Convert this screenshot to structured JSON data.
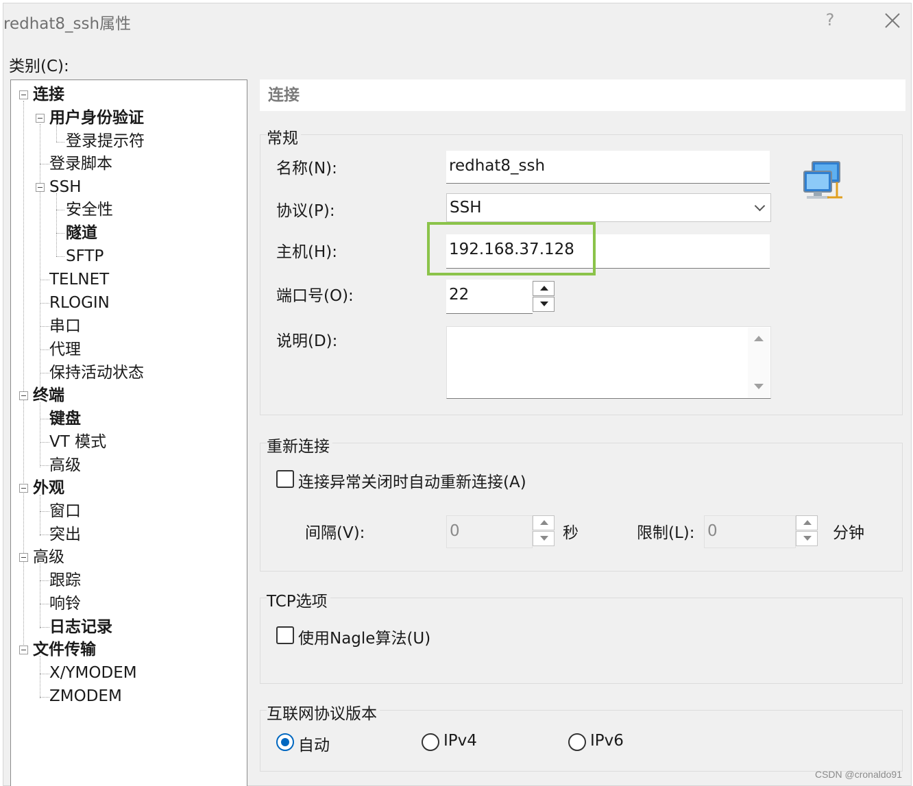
{
  "window": {
    "title": "redhat8_ssh属性",
    "help_label": "?",
    "close_label": "✕"
  },
  "category_label": "类别(C):",
  "tree": {
    "items": [
      {
        "label": "连接"
      },
      {
        "label": "用户身份验证"
      },
      {
        "label": "登录提示符"
      },
      {
        "label": "登录脚本"
      },
      {
        "label": "SSH"
      },
      {
        "label": "安全性"
      },
      {
        "label": "隧道"
      },
      {
        "label": "SFTP"
      },
      {
        "label": "TELNET"
      },
      {
        "label": "RLOGIN"
      },
      {
        "label": "串口"
      },
      {
        "label": "代理"
      },
      {
        "label": "保持活动状态"
      },
      {
        "label": "终端"
      },
      {
        "label": "键盘"
      },
      {
        "label": "VT 模式"
      },
      {
        "label": "高级"
      },
      {
        "label": "外观"
      },
      {
        "label": "窗口"
      },
      {
        "label": "突出"
      },
      {
        "label": "高级"
      },
      {
        "label": "跟踪"
      },
      {
        "label": "响铃"
      },
      {
        "label": "日志记录"
      },
      {
        "label": "文件传输"
      },
      {
        "label": "X/YMODEM"
      },
      {
        "label": "ZMODEM"
      }
    ]
  },
  "panel": {
    "header": "连接",
    "general": {
      "title": "常规",
      "name_label": "名称(N):",
      "name_value": "redhat8_ssh",
      "protocol_label": "协议(P):",
      "protocol_value": "SSH",
      "host_label": "主机(H):",
      "host_value": "192.168.37.128",
      "port_label": "端口号(O):",
      "port_value": "22",
      "desc_label": "说明(D):",
      "desc_value": ""
    },
    "reconnect": {
      "title": "重新连接",
      "auto_label": "连接异常关闭时自动重新连接(A)",
      "interval_label": "间隔(V):",
      "interval_value": "0",
      "interval_unit": "秒",
      "limit_label": "限制(L):",
      "limit_value": "0",
      "limit_unit": "分钟"
    },
    "tcp": {
      "title": "TCP选项",
      "nagle_label": "使用Nagle算法(U)"
    },
    "ip": {
      "title": "互联网协议版本",
      "auto_label": "自动",
      "ipv4_label": "IPv4",
      "ipv6_label": "IPv6",
      "selected": "自动"
    }
  },
  "colors": {
    "highlight": "#8bc34a",
    "radio_accent": "#0067c0"
  },
  "icons": {
    "connection": "network-computers-icon"
  },
  "watermark": "CSDN @cronaldo91"
}
